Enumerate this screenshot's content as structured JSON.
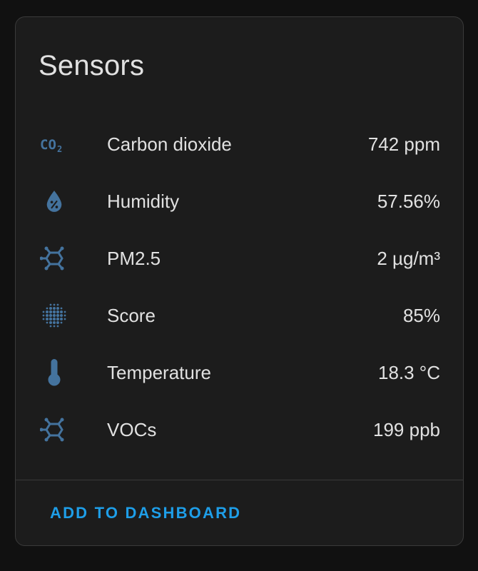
{
  "card": {
    "title": "Sensors"
  },
  "sensors": [
    {
      "icon": "co2-icon",
      "label": "Carbon dioxide",
      "value": "742 ppm"
    },
    {
      "icon": "water-percent-icon",
      "label": "Humidity",
      "value": "57.56%"
    },
    {
      "icon": "molecule-icon",
      "label": "PM2.5",
      "value": "2 µg/m³"
    },
    {
      "icon": "dots-grid-icon",
      "label": "Score",
      "value": "85%"
    },
    {
      "icon": "thermometer-icon",
      "label": "Temperature",
      "value": "18.3 °C"
    },
    {
      "icon": "molecule-icon",
      "label": "VOCs",
      "value": "199 ppb"
    }
  ],
  "actions": {
    "add_to_dashboard": "ADD TO DASHBOARD"
  },
  "colors": {
    "icon": "#44739e",
    "accent": "#1e9ee8",
    "text": "#e1e1e1",
    "card_bg": "#1c1c1c",
    "page_bg": "#111111"
  }
}
